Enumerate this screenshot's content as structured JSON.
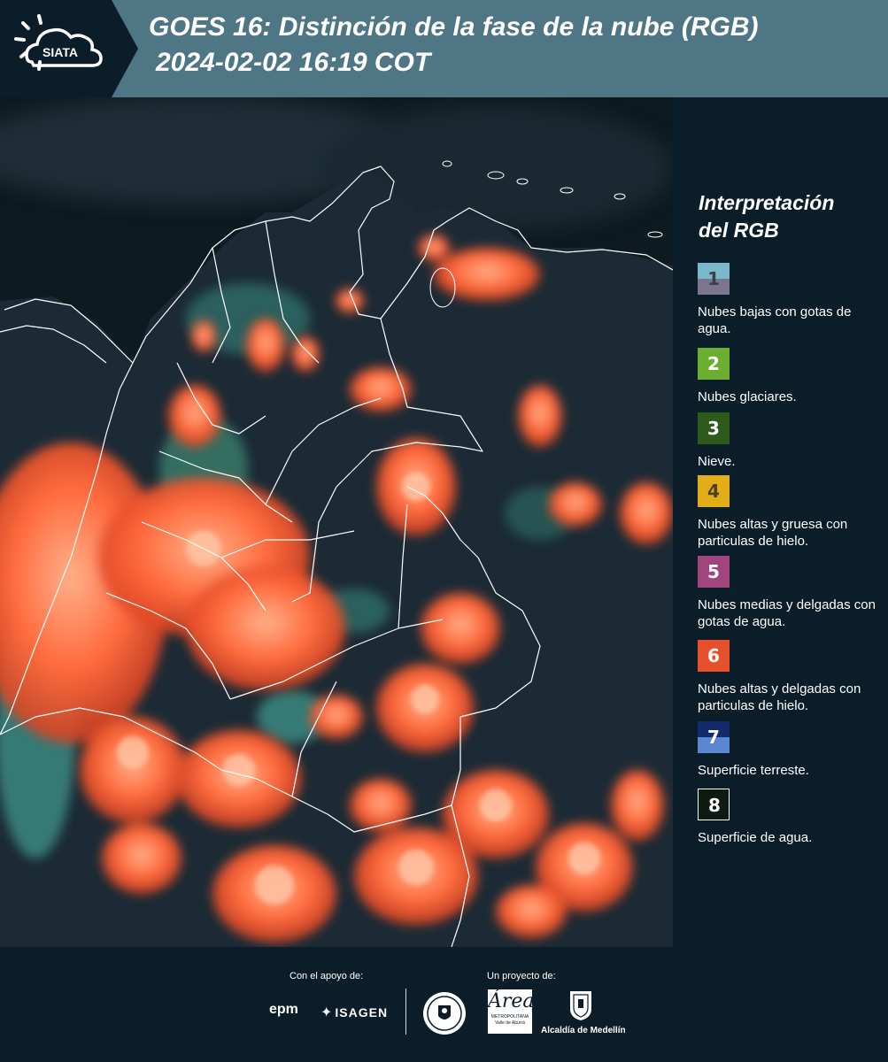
{
  "header": {
    "logo_text": "SIATA",
    "title": "GOES 16: Distinción de la fase de la nube (RGB)",
    "subtitle": "2024-02-02 16:19 COT"
  },
  "map": {
    "description_icon": "satellite-map",
    "colors": {
      "water": "#0d1a20",
      "land": "#1b2a35",
      "cloud_orange": "#ff6a3d",
      "cloud_teal": "#3d8f86",
      "border": "#ffffff"
    }
  },
  "legend": {
    "title_line1": "Interpretación",
    "title_line2": "del RGB",
    "items": [
      {
        "num": "1",
        "label": "Nubes bajas con gotas de agua.",
        "color_top": "#7ab9c9",
        "color_bottom": "#7b7590",
        "num_color": "#3e3e4a"
      },
      {
        "num": "2",
        "label": "Nubes glaciares.",
        "color_top": "#6cae2f",
        "color_bottom": "#6cae2f",
        "num_color": "#ffffff"
      },
      {
        "num": "3",
        "label": "Nieve.",
        "color_top": "#2e5a1c",
        "color_bottom": "#2e5a1c",
        "num_color": "#ffffff"
      },
      {
        "num": "4",
        "label": "Nubes altas y gruesa con particulas de hielo.",
        "color_top": "#e2ad17",
        "color_bottom": "#e2ad17",
        "num_color": "#4d4020"
      },
      {
        "num": "5",
        "label": "Nubes medias y delgadas con gotas de agua.",
        "color_top": "#a0457e",
        "color_bottom": "#a0457e",
        "num_color": "#ffffff"
      },
      {
        "num": "6",
        "label": "Nubes altas y delgadas con particulas de hielo.",
        "color_top": "#e8502b",
        "color_bottom": "#e8502b",
        "num_color": "#ffffff"
      },
      {
        "num": "7",
        "label": "Superficie terreste.",
        "color_top": "#152a6b",
        "color_bottom": "#5b86d1",
        "num_color": "#ffffff"
      },
      {
        "num": "8",
        "label": "Superficie de agua.",
        "color_top": "#0d1a12",
        "color_bottom": "#0d1a12",
        "num_color": "#ffffff"
      }
    ]
  },
  "footer": {
    "support_label": "Con el apoyo de:",
    "project_label": "Un proyecto de:",
    "epm": "epm",
    "isagen": "ISAGEN",
    "area_a": "Área",
    "area_line1": "METROPOLITANA",
    "area_line2": "Valle de Aburrá",
    "alcaldia": "Alcaldía de Medellín"
  }
}
